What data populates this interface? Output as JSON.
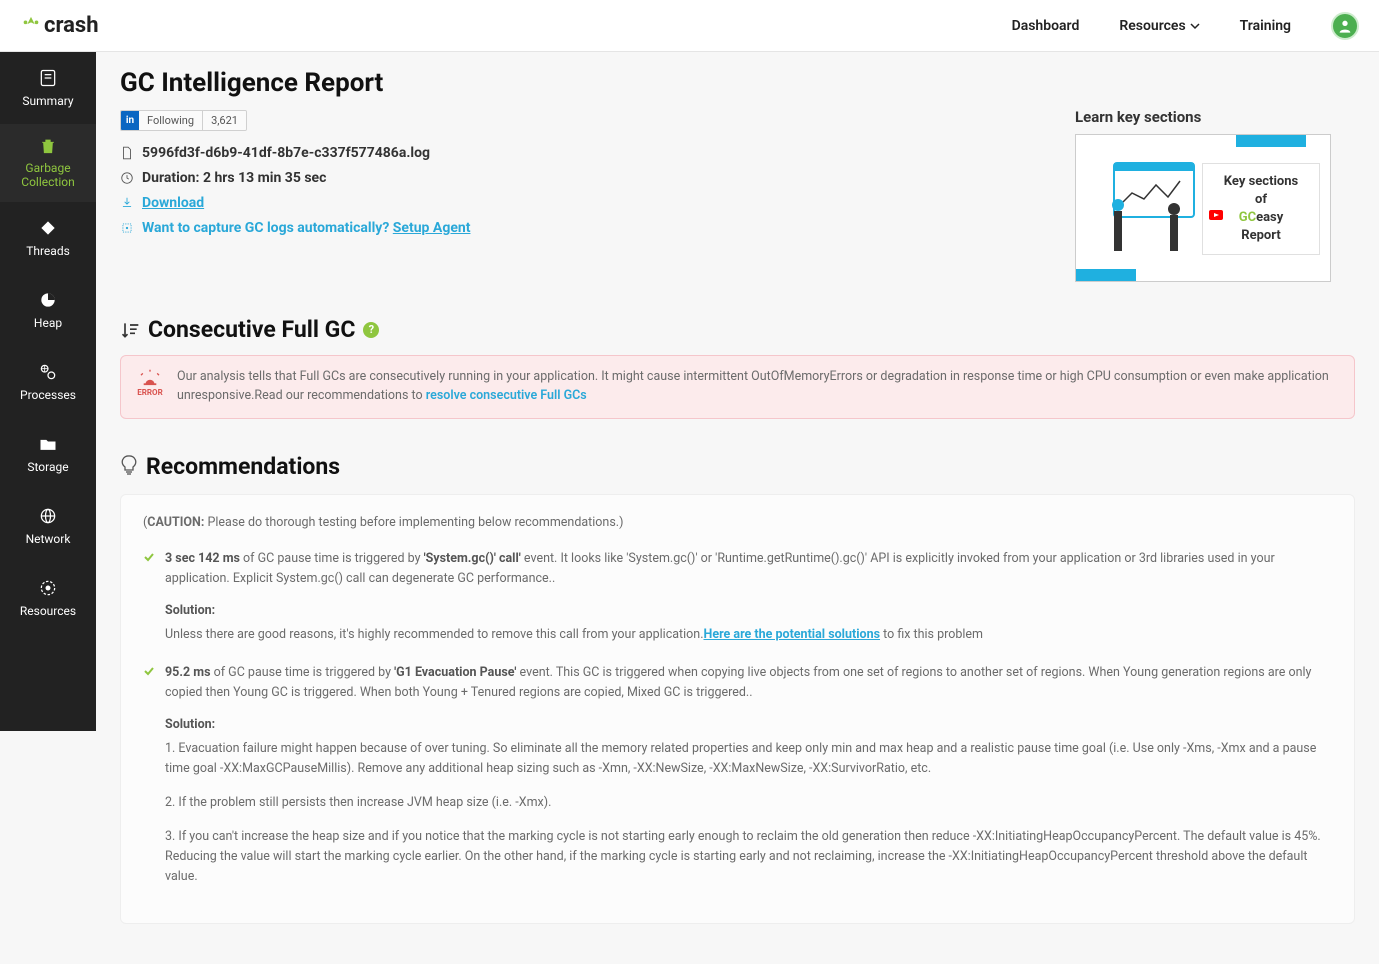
{
  "brand": "crash",
  "nav": {
    "dashboard": "Dashboard",
    "resources": "Resources",
    "training": "Training"
  },
  "sidebar": {
    "summary": "Summary",
    "garbage": "Garbage Collection",
    "threads": "Threads",
    "heap": "Heap",
    "processes": "Processes",
    "storage": "Storage",
    "network": "Network",
    "resources": "Resources"
  },
  "page": {
    "title": "GC Intelligence Report",
    "li_following": "Following",
    "li_count": "3,621",
    "filename": "5996fd3f-d6b9-41df-8b7e-c337f577486a.log",
    "duration_label": "Duration: ",
    "duration_value": "2 hrs 13 min 35 sec",
    "download": "Download",
    "capture_prompt": "Want to capture GC logs automatically? ",
    "setup_agent": "Setup Agent",
    "learn_title": "Learn key sections",
    "video_line1": "Key sections",
    "video_line2": "of",
    "video_line3a": "GC",
    "video_line3b": "easy",
    "video_line4": "Report"
  },
  "consec": {
    "title": "Consecutive Full GC",
    "error_label": "ERROR",
    "alert_text": "Our analysis tells that Full GCs are consecutively running in your application. It might cause intermittent OutOfMemoryErrors or degradation in response time or high CPU consumption or even make application unresponsive.Read our recommendations to ",
    "alert_link": "resolve consecutive Full GCs"
  },
  "recs": {
    "title": "Recommendations",
    "caution_label": "CAUTION:",
    "caution_text": " Please do thorough testing before implementing below recommendations.)",
    "item1": {
      "time": "3 sec 142 ms",
      "text1": " of GC pause time is triggered by ",
      "trigger": "'System.gc()' call'",
      "text2": " event. It looks like 'System.gc()' or 'Runtime.getRuntime().gc()' API is explicitly invoked from your application or 3rd libraries used in your application. Explicit System.gc() call can degenerate GC performance..",
      "solution_label": "Solution:",
      "solution_text1": "Unless there are good reasons, it's highly recommended to remove this call from your application.",
      "solution_link": "Here are the potential solutions",
      "solution_text2": " to fix this problem"
    },
    "item2": {
      "time": "95.2 ms",
      "text1": " of GC pause time is triggered by ",
      "trigger": "'G1 Evacuation Pause'",
      "text2": " event. This GC is triggered when copying live objects from one set of regions to another set of regions. When Young generation regions are only copied then Young GC is triggered. When both Young + Tenured regions are copied, Mixed GC is triggered..",
      "solution_label": "Solution:",
      "sol1": "1. Evacuation failure might happen because of over tuning. So eliminate all the memory related properties and keep only min and max heap and a realistic pause time goal (i.e. Use only -Xms, -Xmx and a pause time goal -XX:MaxGCPauseMillis). Remove any additional heap sizing such as -Xmn, -XX:NewSize, -XX:MaxNewSize, -XX:SurvivorRatio, etc.",
      "sol2": "2. If the problem still persists then increase JVM heap size (i.e. -Xmx).",
      "sol3": "3. If you can't increase the heap size and if you notice that the marking cycle is not starting early enough to reclaim the old generation then reduce -XX:InitiatingHeapOccupancyPercent. The default value is 45%. Reducing the value will start the marking cycle earlier. On the other hand, if the marking cycle is starting early and not reclaiming, increase the -XX:InitiatingHeapOccupancyPercent threshold above the default value."
    }
  }
}
